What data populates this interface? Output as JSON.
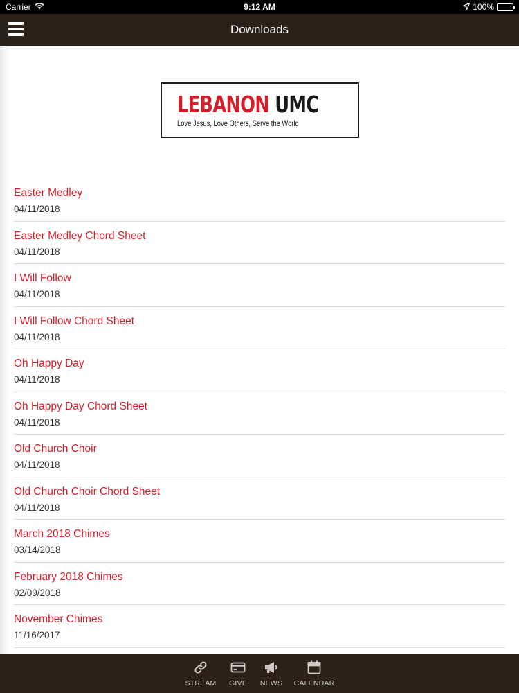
{
  "status_bar": {
    "carrier": "Carrier",
    "time": "9:12 AM",
    "battery": "100%",
    "battery_level": 1.0
  },
  "nav": {
    "title": "Downloads",
    "menu_icon": "hamburger-menu-icon"
  },
  "logo": {
    "name_red": "LEBANON",
    "name_black": "UMC",
    "tagline": "Love Jesus, Love Others, Serve the World",
    "mark_icon": "cross-flame-hands-icon"
  },
  "downloads": [
    {
      "title": "Easter Medley",
      "date": "04/11/2018"
    },
    {
      "title": "Easter Medley Chord Sheet",
      "date": "04/11/2018"
    },
    {
      "title": "I Will Follow",
      "date": "04/11/2018"
    },
    {
      "title": "I Will Follow Chord Sheet",
      "date": "04/11/2018"
    },
    {
      "title": "Oh Happy Day",
      "date": "04/11/2018"
    },
    {
      "title": "Oh Happy Day Chord Sheet",
      "date": "04/11/2018"
    },
    {
      "title": "Old Church Choir",
      "date": "04/11/2018"
    },
    {
      "title": "Old Church Choir Chord Sheet",
      "date": "04/11/2018"
    },
    {
      "title": "March 2018 Chimes",
      "date": "03/14/2018"
    },
    {
      "title": "February 2018 Chimes",
      "date": "02/09/2018"
    },
    {
      "title": "November Chimes",
      "date": "11/16/2017"
    }
  ],
  "tabs": [
    {
      "label": "STREAM",
      "icon": "link-icon"
    },
    {
      "label": "GIVE",
      "icon": "credit-card-icon"
    },
    {
      "label": "NEWS",
      "icon": "megaphone-icon"
    },
    {
      "label": "CALENDAR",
      "icon": "calendar-icon"
    }
  ],
  "colors": {
    "accent": "#d41f2b",
    "bar_background": "#2b2118",
    "tab_label": "#d0cbc6"
  }
}
